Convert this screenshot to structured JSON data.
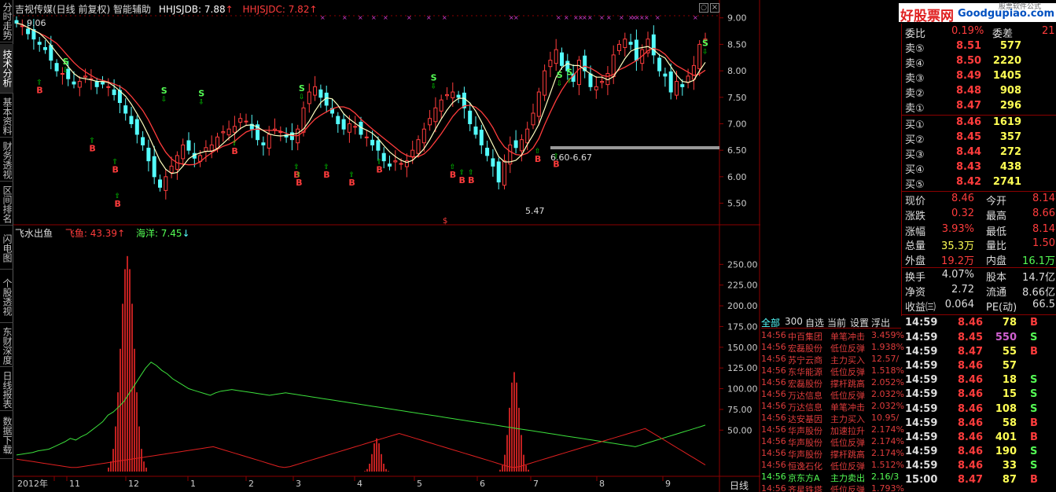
{
  "left_tabs": [
    "分时走势",
    "技术分析",
    "基本资料",
    "财务透视",
    "区间排名",
    "闪电图",
    "个股透视",
    "东财深度",
    "日线报表",
    "数据下载"
  ],
  "header": {
    "name": "吉视传媒(日线 前复权) 智能辅助",
    "l1": "HHJSJDB: 7.88",
    "a1": "↑",
    "l2": "HHJSJDC: 7.82",
    "a2": "↑"
  },
  "sub_header": {
    "name": "飞水出鱼",
    "l1": "飞鱼: 43.39",
    "a1": "↑",
    "l2": "海洋: 7.45",
    "a2": "↓"
  },
  "main_axis": [
    "9.00",
    "8.50",
    "8.00",
    "7.50",
    "7.00",
    "6.50",
    "6.00",
    "5.50"
  ],
  "sub_axis": [
    "250.00",
    "225.00",
    "200.00",
    "175.00",
    "150.00",
    "125.00",
    "100.00",
    "75.00",
    "50.00"
  ],
  "annotations": {
    "high": "9.06",
    "low": "5.47",
    "range": "6.60-6.67"
  },
  "time_axis": [
    "2012年",
    "11",
    "12",
    "1",
    "2",
    "3",
    "4",
    "5",
    "6",
    "7",
    "8",
    "9"
  ],
  "period_label": "日线",
  "watermark": {
    "title": "好股票网",
    "url": "Goodgupiao.com",
    "sub": "股票软件公式"
  },
  "order_book": {
    "ratio": {
      "label": "委比",
      "value": "0.19%",
      "label2": "委差",
      "value2": "21"
    },
    "asks": [
      [
        "卖⑤",
        "8.51",
        "577"
      ],
      [
        "卖④",
        "8.50",
        "2220"
      ],
      [
        "卖③",
        "8.49",
        "1405"
      ],
      [
        "卖②",
        "8.48",
        "908"
      ],
      [
        "卖①",
        "8.47",
        "296"
      ]
    ],
    "bids": [
      [
        "买①",
        "8.46",
        "1619"
      ],
      [
        "买②",
        "8.45",
        "357"
      ],
      [
        "买③",
        "8.44",
        "272"
      ],
      [
        "买④",
        "8.43",
        "438"
      ],
      [
        "买⑤",
        "8.42",
        "2741"
      ]
    ]
  },
  "quote": [
    [
      "现价",
      "8.46",
      "今开",
      "8.14"
    ],
    [
      "涨跌",
      "0.32",
      "最高",
      "8.66"
    ],
    [
      "涨幅",
      "3.93%",
      "最低",
      "8.14"
    ],
    [
      "总量",
      "35.3万",
      "量比",
      "1.50"
    ],
    [
      "外盘",
      "19.2万",
      "内盘",
      "16.1万"
    ],
    [
      "换手",
      "4.07%",
      "股本",
      "14.7亿"
    ],
    [
      "净资",
      "2.72",
      "流通",
      "8.66亿"
    ],
    [
      "收益㈢",
      "0.064",
      "PE(动)",
      "66.5"
    ]
  ],
  "filter_tabs": [
    "全部",
    "300",
    "自选",
    "当前",
    "设置",
    "浮出"
  ],
  "alerts": [
    [
      "14:56",
      "中百集团",
      "单笔冲击",
      "3.459%"
    ],
    [
      "14:56",
      "宏磊股份",
      "低位反弹",
      "1.938%"
    ],
    [
      "14:56",
      "苏宁云商",
      "主力买入",
      "12.57/"
    ],
    [
      "14:56",
      "东华能源",
      "低位反弹",
      "1.518%"
    ],
    [
      "14:56",
      "宏磊股份",
      "撑杆跳高",
      "2.052%"
    ],
    [
      "14:56",
      "万达信息",
      "低位反弹",
      "2.032%"
    ],
    [
      "14:56",
      "万达信息",
      "单笔冲击",
      "2.032%"
    ],
    [
      "14:56",
      "达安基因",
      "主力买入",
      "10.95/"
    ],
    [
      "14:56",
      "华声股份",
      "加速拉升",
      "2.174%"
    ],
    [
      "14:56",
      "华声股份",
      "低位反弹",
      "2.174%"
    ],
    [
      "14:56",
      "华声股份",
      "撑杆跳高",
      "2.174%"
    ],
    [
      "14:56",
      "恒逸石化",
      "低位反弹",
      "1.512%"
    ],
    [
      "14:56",
      "京东方A",
      "主力卖出",
      "2.16/3"
    ],
    [
      "14:56",
      "齐星铁塔",
      "低位反弹",
      "1.793%"
    ]
  ],
  "ticks": [
    [
      "14:59",
      "8.46",
      "78",
      "B"
    ],
    [
      "14:59",
      "8.45",
      "550",
      "S"
    ],
    [
      "14:59",
      "8.47",
      "55",
      "B"
    ],
    [
      "14:59",
      "8.46",
      "57",
      ""
    ],
    [
      "14:59",
      "8.46",
      "18",
      "S"
    ],
    [
      "14:59",
      "8.46",
      "15",
      "S"
    ],
    [
      "14:59",
      "8.46",
      "108",
      "S"
    ],
    [
      "14:59",
      "8.46",
      "58",
      "B"
    ],
    [
      "14:59",
      "8.46",
      "401",
      "B"
    ],
    [
      "14:59",
      "8.46",
      "190",
      "S"
    ],
    [
      "14:59",
      "8.46",
      "33",
      "S"
    ],
    [
      "15:00",
      "8.47",
      "87",
      "B"
    ]
  ],
  "colors": {
    "up": "#ff3c3c",
    "down": "#54fcfc",
    "yellow": "#ffff54",
    "green": "#00e000",
    "grid": "#8b0000"
  },
  "chart_data": {
    "type": "candlestick",
    "main_ylim": [
      5.3,
      9.1
    ],
    "sub_ylim": [
      0,
      275
    ],
    "closes": [
      8.9,
      8.85,
      8.7,
      8.6,
      8.5,
      8.4,
      8.2,
      8.0,
      7.95,
      7.85,
      7.75,
      7.8,
      7.9,
      7.85,
      7.7,
      7.75,
      7.7,
      7.55,
      7.4,
      7.2,
      7.0,
      6.8,
      6.6,
      6.3,
      6.0,
      5.8,
      6.0,
      6.2,
      6.4,
      6.6,
      6.5,
      6.35,
      6.4,
      6.55,
      6.6,
      6.75,
      6.85,
      6.9,
      6.95,
      7.1,
      7.05,
      6.9,
      6.7,
      6.6,
      6.8,
      6.9,
      6.85,
      6.75,
      6.7,
      6.9,
      7.3,
      7.6,
      7.7,
      7.5,
      7.35,
      7.2,
      7.0,
      6.9,
      7.0,
      6.95,
      6.8,
      6.75,
      6.6,
      6.5,
      6.3,
      6.2,
      6.3,
      6.25,
      6.3,
      6.5,
      6.7,
      6.9,
      7.1,
      7.3,
      7.45,
      7.55,
      7.6,
      7.5,
      7.3,
      7.0,
      6.8,
      6.6,
      6.4,
      6.2,
      5.9,
      6.3,
      6.6,
      6.55,
      6.7,
      6.9,
      7.2,
      7.6,
      8.0,
      8.2,
      8.4,
      8.1,
      8.0,
      7.8,
      8.2,
      8.0,
      7.7,
      7.7,
      7.8,
      7.95,
      8.3,
      8.5,
      8.6,
      8.5,
      8.2,
      8.4,
      8.6,
      8.3,
      8.0,
      7.9,
      7.6,
      7.8,
      7.7,
      7.9,
      8.1,
      8.5,
      8.6
    ],
    "signals_B": [
      [
        10,
        7.7
      ],
      [
        33,
        6.6
      ],
      [
        43,
        6.2
      ],
      [
        44,
        5.55
      ],
      [
        95,
        6.55
      ],
      [
        122,
        6.1
      ],
      [
        123,
        5.95
      ],
      [
        135,
        6.1
      ],
      [
        146,
        5.95
      ],
      [
        158,
        6.2
      ],
      [
        190,
        6.1
      ],
      [
        194,
        6.0
      ],
      [
        198,
        6.0
      ],
      [
        227,
        6.4
      ],
      [
        235,
        6.3
      ]
    ],
    "signals_S": [
      [
        25,
        8.0
      ],
      [
        75,
        7.45
      ],
      [
        94,
        7.4
      ],
      [
        145,
        7.5
      ],
      [
        212,
        7.7
      ],
      [
        276,
        7.75
      ],
      [
        281,
        7.8
      ],
      [
        350,
        8.35
      ]
    ],
    "fish": [
      20,
      21,
      22,
      23,
      25,
      26,
      27,
      30,
      33,
      36,
      40,
      38,
      42,
      45,
      50,
      55,
      60,
      68,
      72,
      78,
      85,
      95,
      105,
      115,
      125,
      132,
      128,
      122,
      118,
      112,
      108,
      104,
      100,
      98,
      96,
      94,
      92,
      95,
      97,
      98,
      99,
      98,
      97,
      96,
      95,
      94,
      93,
      92,
      93,
      94,
      95,
      94,
      93,
      92,
      91,
      90,
      89,
      88,
      87,
      86,
      85,
      84,
      83,
      82,
      81,
      80,
      79,
      78,
      77,
      76,
      75,
      74,
      73,
      72,
      71,
      70,
      69,
      68,
      67,
      66,
      65,
      64,
      63,
      62,
      61,
      60,
      59,
      58,
      57,
      56,
      55,
      54,
      53,
      52,
      51,
      50,
      49,
      48,
      47,
      46,
      45,
      44,
      43,
      42,
      41,
      40,
      39,
      38,
      37,
      36,
      35,
      34,
      33,
      32,
      31,
      30,
      32,
      34,
      36,
      38,
      40,
      42,
      44,
      46,
      48,
      50,
      52,
      54,
      56
    ],
    "ocean": [
      15,
      14,
      13,
      12,
      11,
      10,
      9,
      8,
      7,
      6,
      5,
      5,
      6,
      7,
      8,
      9,
      10,
      11,
      12,
      13,
      14,
      15,
      16,
      17,
      18,
      19,
      20,
      21,
      22,
      23,
      24,
      25,
      26,
      27,
      28,
      29,
      30,
      28,
      26,
      24,
      22,
      20,
      18,
      16,
      14,
      12,
      10,
      8,
      6,
      5,
      6,
      8,
      10,
      12,
      14,
      16,
      18,
      20,
      22,
      24,
      26,
      28,
      30,
      32,
      34,
      36,
      38,
      40,
      42,
      44,
      46,
      44,
      42,
      40,
      38,
      36,
      34,
      32,
      30,
      28,
      26,
      24,
      22,
      20,
      18,
      16,
      14,
      12,
      10,
      8,
      6,
      5,
      6,
      8,
      10,
      12,
      14,
      16,
      18,
      20,
      22,
      24,
      26,
      28,
      30,
      32,
      34,
      36,
      38,
      40,
      42,
      44,
      46,
      48,
      50,
      52,
      48,
      44,
      40,
      36,
      32,
      28,
      24,
      20,
      16,
      12,
      8
    ]
  }
}
